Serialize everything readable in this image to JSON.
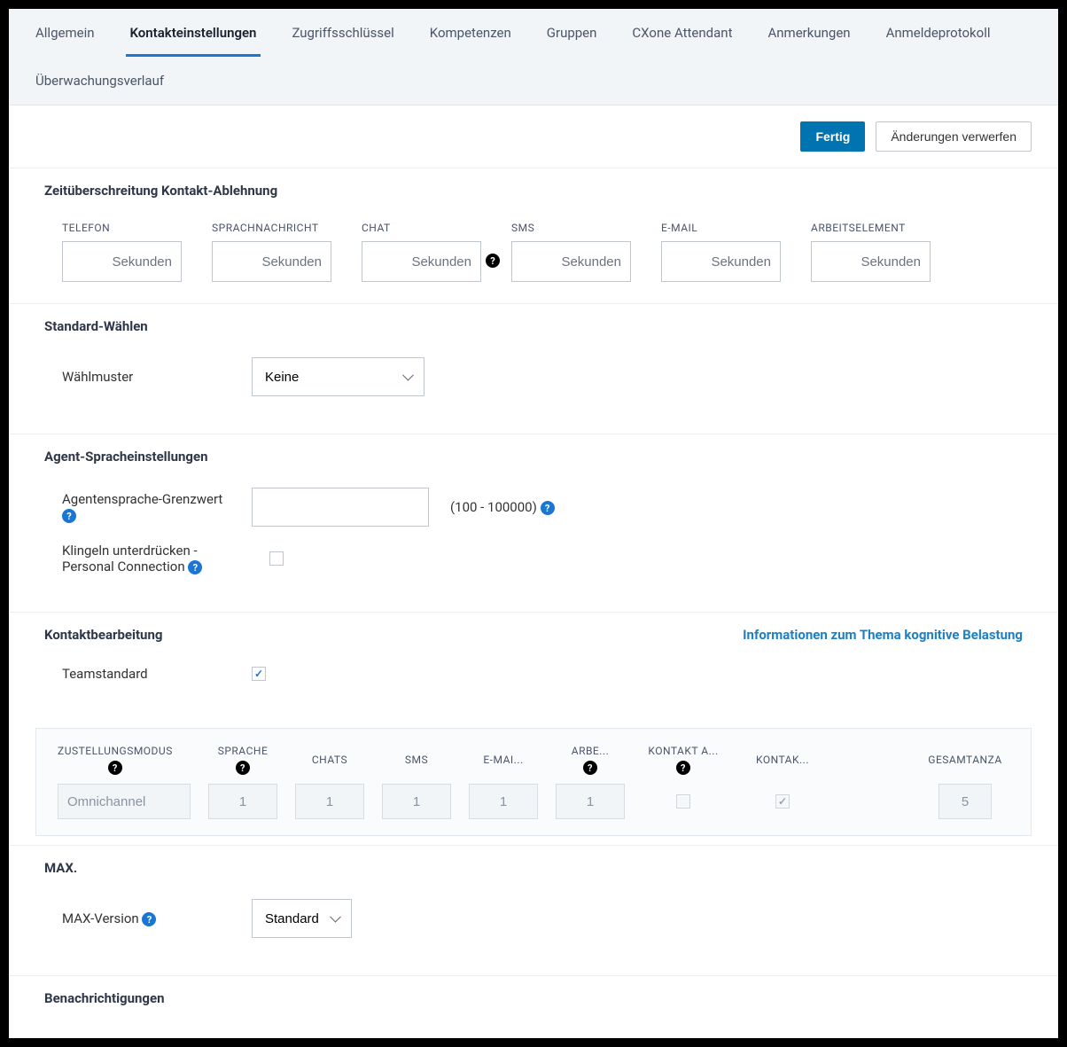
{
  "tabs": {
    "general": "Allgemein",
    "contact_settings": "Kontakteinstellungen",
    "access_keys": "Zugriffsschlüssel",
    "skills": "Kompetenzen",
    "groups": "Gruppen",
    "cxone_attendant": "CXone Attendant",
    "notes": "Anmerkungen",
    "login_log": "Anmeldeprotokoll",
    "monitoring_history": "Überwachungsverlauf"
  },
  "buttons": {
    "done": "Fertig",
    "discard": "Änderungen verwerfen"
  },
  "sections": {
    "timeout": {
      "title": "Zeitüberschreitung Kontakt-Ablehnung",
      "cols": {
        "phone": "TELEFON",
        "voicemail": "SPRACHNACHRICHT",
        "chat": "CHAT",
        "sms": "SMS",
        "email": "E-MAIL",
        "workitem": "ARBEITSELEMENT"
      },
      "placeholder": "Sekunden"
    },
    "default_dial": {
      "title": "Standard-Wählen",
      "pattern_label": "Wählmuster",
      "pattern_value": "Keine"
    },
    "agent_voice": {
      "title": "Agent-Spracheinstellungen",
      "threshold_label": "Agentensprache-Grenzwert",
      "range_hint": "(100 - 100000)",
      "suppress_label": "Klingeln unterdrücken - Personal Connection"
    },
    "contact_handling": {
      "title": "Kontaktbearbeitung",
      "link": "Informationen zum Thema kognitive Belastung",
      "team_default_label": "Teamstandard"
    },
    "delivery": {
      "headers": {
        "mode": "ZUSTELLUNGSMODUS",
        "voice": "SPRACHE",
        "chats": "CHATS",
        "sms": "SMS",
        "email": "E-MAI...",
        "work": "ARBE...",
        "contact_a": "KONTAKT A...",
        "kontak": "KONTAK...",
        "total": "GESAMTANZA"
      },
      "values": {
        "mode": "Omnichannel",
        "voice": "1",
        "chats": "1",
        "sms": "1",
        "email": "1",
        "work": "1",
        "total": "5"
      }
    },
    "max": {
      "title": "MAX.",
      "version_label": "MAX-Version",
      "version_value": "Standard"
    },
    "notifications": {
      "title": "Benachrichtigungen"
    }
  }
}
